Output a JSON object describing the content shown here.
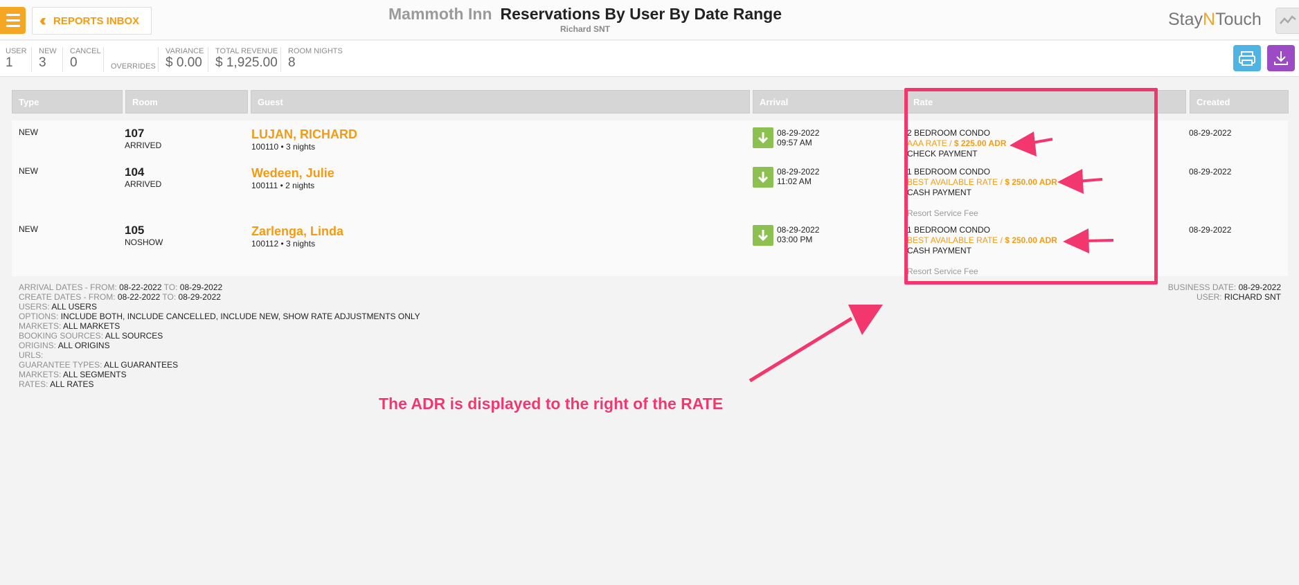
{
  "header": {
    "inbox_label": "REPORTS INBOX",
    "hotel_name": "Mammoth Inn",
    "report_title": "Reservations By User By Date Range",
    "subtitle": "Richard SNT",
    "logo_a": "Stay",
    "logo_n": "N",
    "logo_b": "Touch"
  },
  "summary": {
    "user_label": "USER",
    "user_value": "1",
    "new_label": "NEW",
    "new_value": "3",
    "cancel_label": "CANCEL",
    "cancel_value": "0",
    "overrides_label": "OVERRIDES",
    "variance_label": "VARIANCE",
    "variance_value": "$ 0.00",
    "revenue_label": "TOTAL REVENUE",
    "revenue_value": "$ 1,925.00",
    "nights_label": "ROOM NIGHTS",
    "nights_value": "8"
  },
  "table": {
    "headers": [
      "Type",
      "Room",
      "Guest",
      "Arrival",
      "Rate",
      "Created"
    ],
    "rows": [
      {
        "type": "NEW",
        "room": "107",
        "status": "ARRIVED",
        "guest": "LUJAN, RICHARD",
        "confirmation": "100110",
        "nights": "• 3 nights",
        "arr_date": "08-29-2022",
        "arr_time": "09:57 AM",
        "room_type": "2 BEDROOM CONDO",
        "rate_name": "AAA RATE",
        "adr": "$ 225.00 ADR",
        "payment": "CHECK PAYMENT",
        "fee": "",
        "created": "08-29-2022"
      },
      {
        "type": "NEW",
        "room": "104",
        "status": "ARRIVED",
        "guest": "Wedeen, Julie",
        "confirmation": "100111",
        "nights": "• 2 nights",
        "arr_date": "08-29-2022",
        "arr_time": "11:02 AM",
        "room_type": "1 BEDROOM CONDO",
        "rate_name": "BEST AVAILABLE RATE",
        "adr": "$ 250.00 ADR",
        "payment": "CASH PAYMENT",
        "fee": "Resort Service Fee",
        "created": "08-29-2022"
      },
      {
        "type": "NEW",
        "room": "105",
        "status": "NOSHOW",
        "guest": "Zarlenga, Linda",
        "confirmation": "100112",
        "nights": "• 3 nights",
        "arr_date": "08-29-2022",
        "arr_time": "03:00 PM",
        "room_type": "1 BEDROOM CONDO",
        "rate_name": "BEST AVAILABLE RATE",
        "adr": "$ 250.00 ADR",
        "payment": "CASH PAYMENT",
        "fee": "Resort Service Fee",
        "created": "08-29-2022"
      }
    ],
    "rate_separator": " / "
  },
  "filters": {
    "arrival_label": "ARRIVAL DATES - FROM:",
    "arrival_from": "08-22-2022",
    "to_label": "TO:",
    "arrival_to": "08-29-2022",
    "create_label": "CREATE DATES - FROM:",
    "create_from": "08-22-2022",
    "create_to": "08-29-2022",
    "users_label": "USERS:",
    "users_value": "ALL USERS",
    "options_label": "OPTIONS:",
    "options_value": "INCLUDE BOTH, INCLUDE CANCELLED, INCLUDE NEW, SHOW RATE ADJUSTMENTS ONLY",
    "markets_label": "MARKETS:",
    "markets_value": "ALL MARKETS",
    "sources_label": "BOOKING SOURCES:",
    "sources_value": "ALL SOURCES",
    "origins_label": "ORIGINS:",
    "origins_value": "ALL ORIGINS",
    "urls_label": "URLS:",
    "urls_value": "",
    "guarantee_label": "GUARANTEE TYPES:",
    "guarantee_value": "ALL GUARANTEES",
    "markets2_label": "MARKETS:",
    "markets2_value": "ALL SEGMENTS",
    "rates_label": "RATES:",
    "rates_value": "ALL RATES",
    "business_label": "BUSINESS DATE:",
    "business_value": "08-29-2022",
    "user_label": "USER:",
    "user_value": "RICHARD SNT"
  },
  "annotation": {
    "text": "The ADR is displayed to the right of the RATE",
    "color": "#f2366e"
  },
  "colors": {
    "accent": "#f5a623",
    "arrival_green": "#8cc152",
    "print_blue": "#4fb3e3",
    "download_purple": "#9b4bc3"
  },
  "icons": [
    "menu-icon",
    "double-chevron-left-icon",
    "activity-icon",
    "print-icon",
    "download-icon",
    "arrow-down-icon"
  ]
}
